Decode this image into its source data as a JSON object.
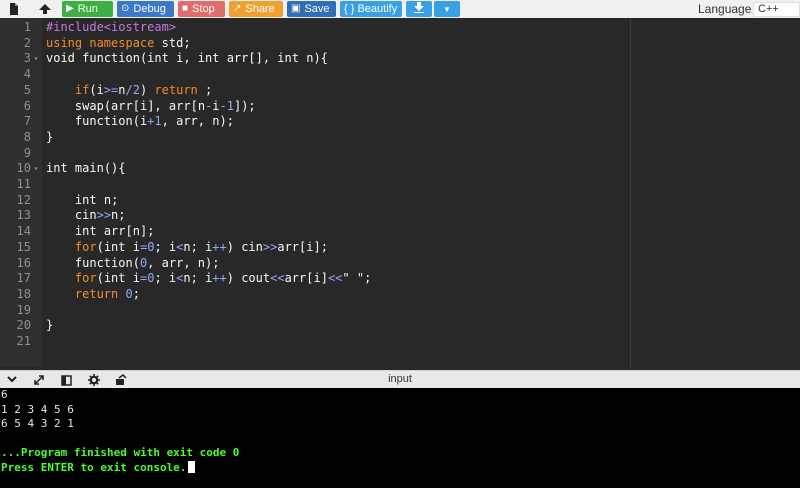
{
  "toolbar": {
    "buttons": {
      "run": {
        "label": "Run",
        "color": "#3cb043"
      },
      "debug": {
        "label": "Debug",
        "color": "#3a78c9"
      },
      "stop": {
        "label": "Stop",
        "color": "#e06c6c"
      },
      "share": {
        "label": "Share",
        "color": "#f0a030"
      },
      "save": {
        "label": "Save",
        "color": "#2f6eb8"
      },
      "beautify": {
        "label": "{ } Beautify",
        "color": "#3aa0e6"
      }
    },
    "icons": [
      "file-icon",
      "upload-icon",
      "download-icon",
      "chevron-down-icon"
    ],
    "language_label": "Language",
    "language_value": "C++"
  },
  "editor": {
    "lines": [
      {
        "n": "1",
        "fold": "",
        "text": "#include<iostream>"
      },
      {
        "n": "2",
        "fold": "",
        "text": "using namespace std;"
      },
      {
        "n": "3",
        "fold": "▾",
        "text": "void function(int i, int arr[], int n){"
      },
      {
        "n": "4",
        "fold": "",
        "text": ""
      },
      {
        "n": "5",
        "fold": "",
        "text": "    if(i>=n/2) return ;"
      },
      {
        "n": "6",
        "fold": "",
        "text": "    swap(arr[i], arr[n-i-1]);"
      },
      {
        "n": "7",
        "fold": "",
        "text": "    function(i+1, arr, n);"
      },
      {
        "n": "8",
        "fold": "",
        "text": "}"
      },
      {
        "n": "9",
        "fold": "",
        "text": ""
      },
      {
        "n": "10",
        "fold": "▾",
        "text": "int main(){"
      },
      {
        "n": "11",
        "fold": "",
        "text": ""
      },
      {
        "n": "12",
        "fold": "",
        "text": "    int n;"
      },
      {
        "n": "13",
        "fold": "",
        "text": "    cin>>n;"
      },
      {
        "n": "14",
        "fold": "",
        "text": "    int arr[n];"
      },
      {
        "n": "15",
        "fold": "",
        "text": "    for(int i=0; i<n; i++) cin>>arr[i];"
      },
      {
        "n": "16",
        "fold": "",
        "text": "    function(0, arr, n);"
      },
      {
        "n": "17",
        "fold": "",
        "text": "    for(int i=0; i<n; i++) cout<<arr[i]<<\" \";"
      },
      {
        "n": "18",
        "fold": "",
        "text": "    return 0;"
      },
      {
        "n": "19",
        "fold": "",
        "text": ""
      },
      {
        "n": "20",
        "fold": "",
        "text": "}"
      },
      {
        "n": "21",
        "fold": "",
        "text": ""
      }
    ]
  },
  "output": {
    "title": "input",
    "icons": [
      "chevron-down-icon",
      "expand-icon",
      "panel-icon",
      "gear-icon",
      "share-output-icon"
    ],
    "console_lines": [
      {
        "text": "6",
        "style": "normal"
      },
      {
        "text": "1 2 3 4 5 6",
        "style": "normal"
      },
      {
        "text": "6 5 4 3 2 1",
        "style": "normal"
      },
      {
        "text": "",
        "style": "normal"
      },
      {
        "text": "...Program finished with exit code 0",
        "style": "green"
      },
      {
        "text": "Press ENTER to exit console.",
        "style": "green"
      }
    ]
  }
}
